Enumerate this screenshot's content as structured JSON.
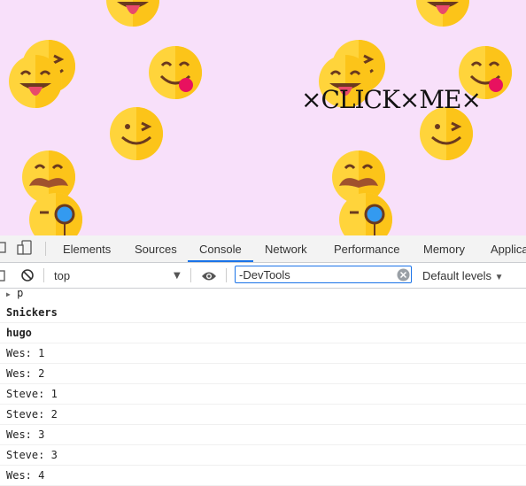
{
  "page": {
    "background_color": "#f8e0fa",
    "click_text": "×CLICK×ME×"
  },
  "devtools": {
    "tabs": [
      "Elements",
      "Sources",
      "Console",
      "Network",
      "Performance",
      "Memory",
      "Applica"
    ],
    "active_tab": "Console",
    "toolbar": {
      "context": "top",
      "filter_value": "-DevTools",
      "levels_label": "Default levels"
    },
    "console_rows": [
      {
        "text": "p",
        "collapsed": true
      },
      {
        "text": "Snickers"
      },
      {
        "text": "hugo"
      },
      {
        "text": "Wes: 1"
      },
      {
        "text": "Wes: 2"
      },
      {
        "text": "Steve: 1"
      },
      {
        "text": "Steve: 2"
      },
      {
        "text": "Wes: 3"
      },
      {
        "text": "Steve: 3"
      },
      {
        "text": "Wes: 4"
      }
    ]
  },
  "icons": {
    "emojis": [
      "tongue-face",
      "winking-tongue-face",
      "smiley-tongue-face",
      "wink-face",
      "mustache-face",
      "monocle-face"
    ],
    "accent": "#1a73e8"
  }
}
